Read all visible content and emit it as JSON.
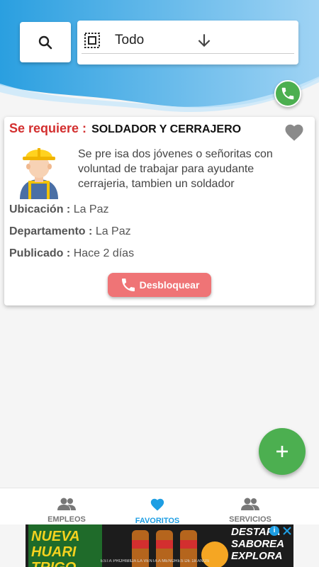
{
  "filter": {
    "value": "Todo"
  },
  "job": {
    "required_label": "Se requiere :",
    "title": "SOLDADOR Y CERRAJERO",
    "description": "Se pre isa dos jóvenes o señoritas con voluntad de trabajar para ayudante cerrajeria, tambien un soldador",
    "ubicacion_label": "Ubicación :",
    "ubicacion_value": "La Paz",
    "departamento_label": "Departamento :",
    "departamento_value": "La Paz",
    "publicado_label": "Publicado :",
    "publicado_value": "Hace 2 días",
    "unlock_label": "Desbloquear"
  },
  "nav": {
    "empleos": "EMPLEOS",
    "favoritos": "FAVORITOS",
    "servicios": "SERVICIOS",
    "active": "favoritos"
  },
  "ad": {
    "left_text": "NUEVA HUARI TRIGO",
    "right_text": "DESTAPA SABOREA EXPLORA",
    "strip_text": "ESTÁ PROHIBIDA LA VENTA A MENORES DE 18 AÑOS"
  },
  "colors": {
    "accent_blue": "#1e9ee3",
    "fab_green": "#4caf50",
    "required_red": "#d32f2f",
    "unlock_button": "#ef7476"
  },
  "icons": [
    "search-icon",
    "select-all-icon",
    "arrow-down-icon",
    "phone-icon",
    "heart-icon",
    "plus-icon",
    "people-icon",
    "close-icon",
    "info-icon"
  ]
}
